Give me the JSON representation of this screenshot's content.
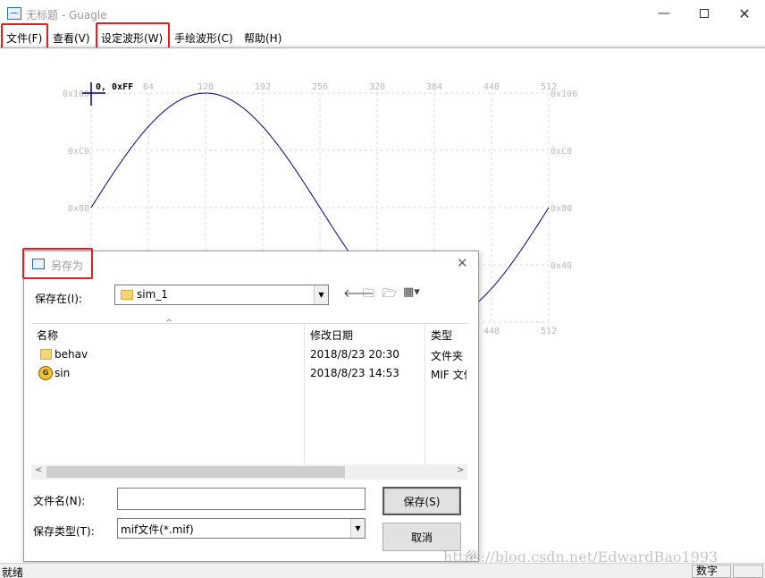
{
  "window": {
    "title": "无标题 - Guagle",
    "minimize": "—",
    "close": "✕"
  },
  "menu": {
    "items": [
      "文件(F)",
      "查看(V)",
      "设定波形(W)",
      "手绘波形(C)",
      "帮助(H)"
    ]
  },
  "chart_data": {
    "type": "line",
    "title": "",
    "cursor_label": "0, 0xFF",
    "x_ticks": [
      "64",
      "128",
      "192",
      "256",
      "320",
      "384",
      "448",
      "512"
    ],
    "x_ticks_bottom_visible": [
      "448",
      "512"
    ],
    "y_ticks_left": [
      "0x100",
      "0xC0",
      "0x80"
    ],
    "y_ticks_right": [
      "0x100",
      "0xC0",
      "0x80",
      "0x40"
    ],
    "xlim": [
      0,
      512
    ],
    "ylim": [
      0,
      256
    ],
    "grid": true,
    "series": [
      {
        "function": "sine",
        "samples": 512,
        "offset": 128,
        "amplitude": 128,
        "color": "#00007f"
      }
    ]
  },
  "dialog": {
    "title": "另存为",
    "close": "✕",
    "save_in_label": "保存在(I):",
    "save_in_value": "sim_1",
    "columns": [
      "名称",
      "修改日期",
      "类型"
    ],
    "files": [
      {
        "name": "behav",
        "date": "2018/8/23 20:30",
        "type": "文件夹",
        "icon": "folder-icon"
      },
      {
        "name": "sin",
        "date": "2018/8/23 14:53",
        "type": "MIF 文件",
        "icon": "mif-file-icon"
      }
    ],
    "filename_label": "文件名(N):",
    "filename_value": "",
    "filetype_label": "保存类型(T):",
    "filetype_value": "mif文件(*.mif)",
    "save_button": "保存(S)",
    "cancel_button": "取消"
  },
  "status": {
    "left": "就绪",
    "pane": "数字"
  },
  "watermark": "https://blog.csdn.net/EdwardBao1993",
  "colors": {
    "highlight": "#e02020",
    "wave": "#00007f",
    "grid": "#d8d8d8"
  }
}
